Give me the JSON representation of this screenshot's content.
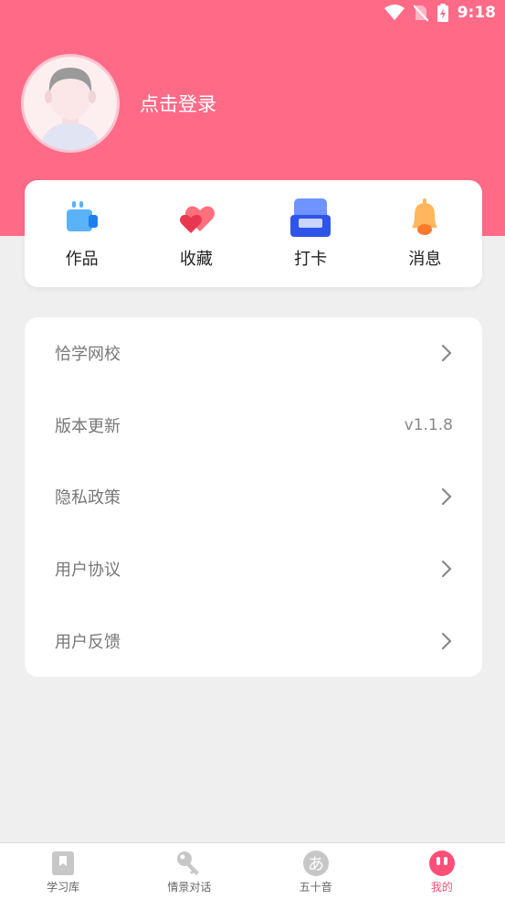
{
  "status_bar": {
    "time": "9:18"
  },
  "profile": {
    "login_text": "点击登录"
  },
  "quick_actions": [
    {
      "label": "作品",
      "icon": "works-icon"
    },
    {
      "label": "收藏",
      "icon": "heart-icon"
    },
    {
      "label": "打卡",
      "icon": "checkin-icon"
    },
    {
      "label": "消息",
      "icon": "bell-icon"
    }
  ],
  "menu": [
    {
      "label": "恰学网校",
      "trailing": "chevron"
    },
    {
      "label": "版本更新",
      "trailing": "v1.1.8"
    },
    {
      "label": "隐私政策",
      "trailing": "chevron"
    },
    {
      "label": "用户协议",
      "trailing": "chevron"
    },
    {
      "label": "用户反馈",
      "trailing": "chevron"
    }
  ],
  "tabs": [
    {
      "label": "学习库",
      "icon": "bookmark-icon"
    },
    {
      "label": "情景对话",
      "icon": "key-icon"
    },
    {
      "label": "五十音",
      "icon": "hiragana-icon"
    },
    {
      "label": "我的",
      "icon": "profile-face-icon",
      "active": true
    }
  ],
  "colors": {
    "header": "#ff6b87",
    "background": "#efefef",
    "active_tab": "#ff4f79"
  }
}
